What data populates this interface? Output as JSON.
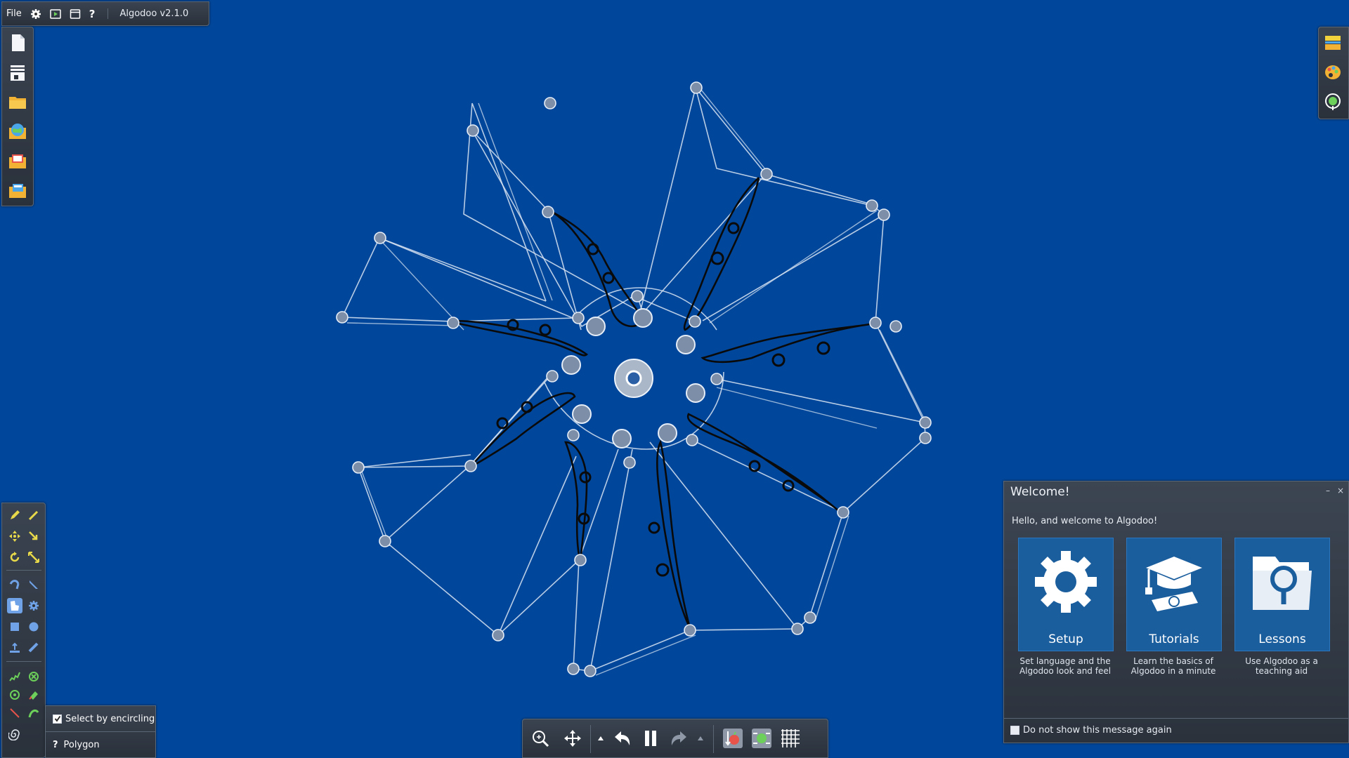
{
  "menu": {
    "file_label": "File",
    "settings_icon": "gear-icon",
    "play_icon": "play-icon",
    "window_icon": "window-icon",
    "help_label": "?",
    "app_title": "Algodoo v2.1.0"
  },
  "options": {
    "select_by_encircling": "Select by encircling",
    "polygon": "Polygon",
    "help_label": "?"
  },
  "welcome": {
    "title": "Welcome!",
    "minimize": "–",
    "close": "×",
    "greeting": "Hello, and welcome to Algodoo!",
    "cards": [
      {
        "label": "Setup",
        "desc": "Set language and the Algodoo look and feel",
        "icon": "gear-icon"
      },
      {
        "label": "Tutorials",
        "desc": "Learn the basics of Algodoo in a minute",
        "icon": "graduation-cap-icon"
      },
      {
        "label": "Lessons",
        "desc": "Use Algodoo as a teaching aid",
        "icon": "magnifier-folder-icon"
      }
    ],
    "dont_show": "Do not show this message again"
  },
  "colors": {
    "background": "#00479b",
    "panel": "#323a45",
    "accent": "#6fa2e6",
    "card": "#1b5e9e"
  }
}
